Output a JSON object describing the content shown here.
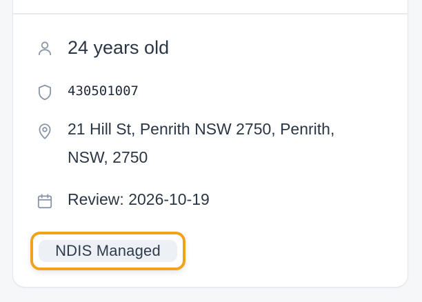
{
  "card": {
    "age": "24 years old",
    "id_number": "430501007",
    "address": "21 Hill St, Penrith NSW 2750, Penrith, NSW, 2750",
    "review": "Review: 2026-10-19",
    "badge": "NDIS Managed"
  },
  "icons": {
    "age": "user-icon",
    "id": "shield-icon",
    "address": "location-pin-icon",
    "review": "calendar-icon"
  },
  "colors": {
    "icon": "#8a96a6",
    "text": "#2b3645",
    "focus_ring": "#f2a11b",
    "badge_bg": "#edf1f5"
  }
}
